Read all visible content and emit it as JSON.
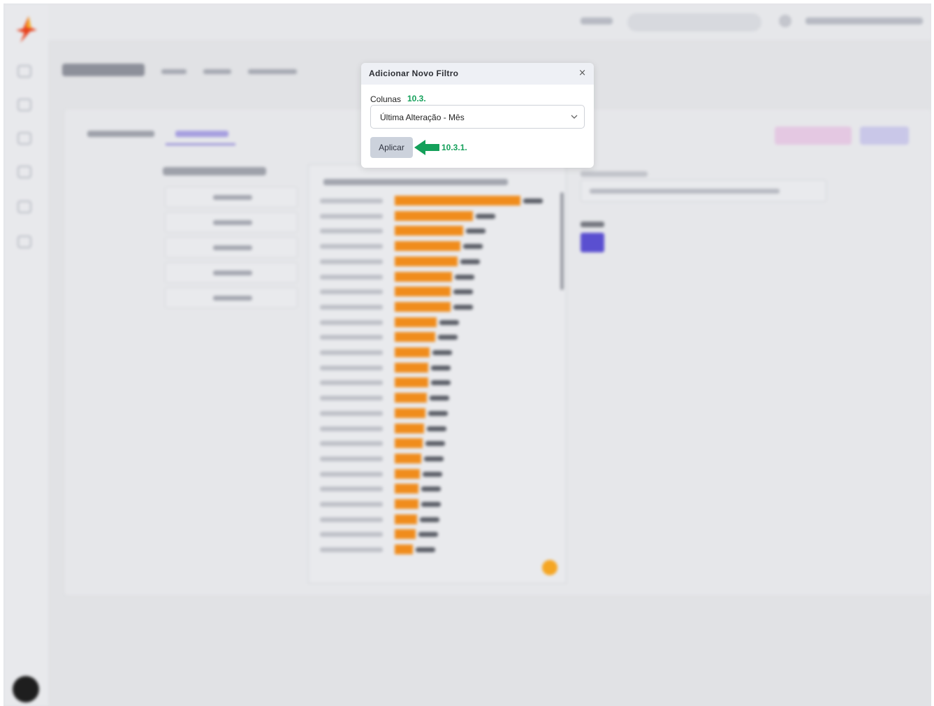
{
  "modal": {
    "title": "Adicionar Novo Filtro",
    "close_label": "×",
    "field_label": "Colunas",
    "field_step": "10.3.",
    "selected_value": "Última Alteração - Mês",
    "apply_label": "Aplicar",
    "apply_step": "10.3.1."
  },
  "colors": {
    "step_green": "#14a05a",
    "bar_orange": "#f08c1c",
    "accent_purple": "#5a4fd0"
  },
  "icons": [
    "close-icon",
    "chevron-down-icon",
    "arrow-left-icon",
    "app-logo-icon"
  ]
}
